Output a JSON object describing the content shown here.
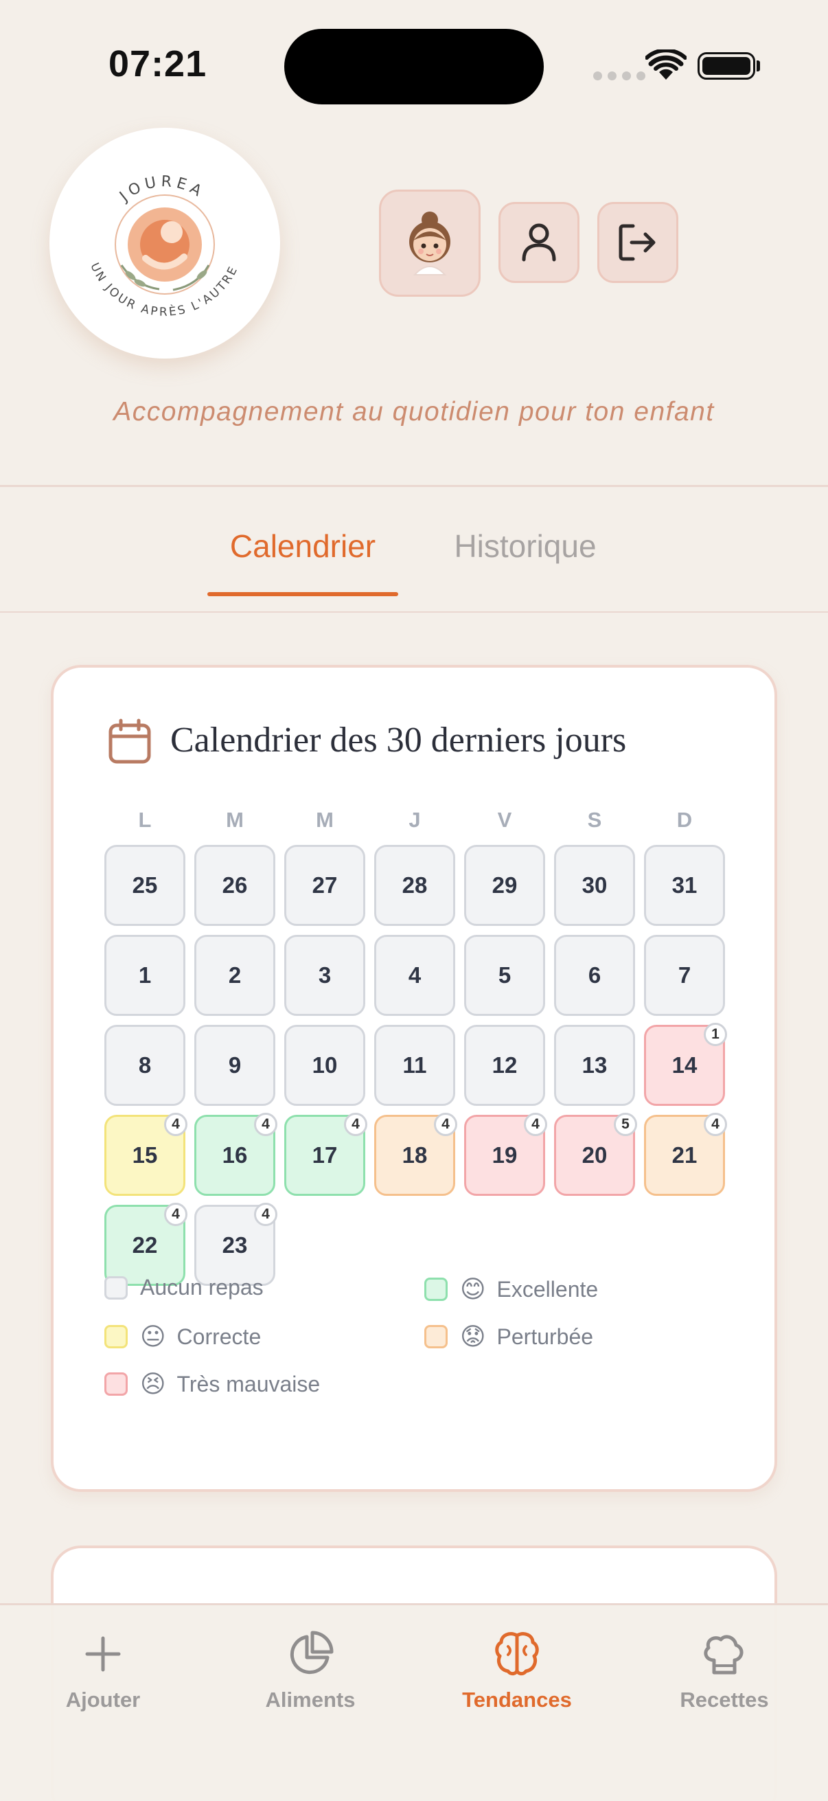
{
  "status_bar": {
    "time": "07:21"
  },
  "header": {
    "logo_text_top": "JOUREA",
    "logo_text_bottom": "UN JOUR APRÈS L'AUTRE",
    "profile_emoji": "👧",
    "tagline": "Accompagnement au quotidien pour ton enfant"
  },
  "tabs": [
    {
      "label": "Calendrier",
      "active": true
    },
    {
      "label": "Historique",
      "active": false
    }
  ],
  "calendar": {
    "title": "Calendrier des 30 derniers jours",
    "weekdays": [
      "L",
      "M",
      "M",
      "J",
      "V",
      "S",
      "D"
    ],
    "days": [
      {
        "n": "25",
        "s": "none"
      },
      {
        "n": "26",
        "s": "none"
      },
      {
        "n": "27",
        "s": "none"
      },
      {
        "n": "28",
        "s": "none"
      },
      {
        "n": "29",
        "s": "none"
      },
      {
        "n": "30",
        "s": "none"
      },
      {
        "n": "31",
        "s": "none"
      },
      {
        "n": "1",
        "s": "none"
      },
      {
        "n": "2",
        "s": "none"
      },
      {
        "n": "3",
        "s": "none"
      },
      {
        "n": "4",
        "s": "none"
      },
      {
        "n": "5",
        "s": "none"
      },
      {
        "n": "6",
        "s": "none"
      },
      {
        "n": "7",
        "s": "none"
      },
      {
        "n": "8",
        "s": "none"
      },
      {
        "n": "9",
        "s": "none"
      },
      {
        "n": "10",
        "s": "none"
      },
      {
        "n": "11",
        "s": "none"
      },
      {
        "n": "12",
        "s": "none"
      },
      {
        "n": "13",
        "s": "none"
      },
      {
        "n": "14",
        "s": "red",
        "count": "1"
      },
      {
        "n": "15",
        "s": "yellow",
        "count": "4"
      },
      {
        "n": "16",
        "s": "green",
        "count": "4"
      },
      {
        "n": "17",
        "s": "green",
        "count": "4"
      },
      {
        "n": "18",
        "s": "orange",
        "count": "4"
      },
      {
        "n": "19",
        "s": "red",
        "count": "4"
      },
      {
        "n": "20",
        "s": "red",
        "count": "5"
      },
      {
        "n": "21",
        "s": "orange",
        "count": "4"
      },
      {
        "n": "22",
        "s": "green",
        "count": "4"
      },
      {
        "n": "23",
        "s": "none",
        "count": "4"
      }
    ],
    "legend": [
      {
        "label": "Aucun repas",
        "s": "none",
        "emoji": ""
      },
      {
        "label": "Excellente",
        "s": "green",
        "emoji": "😊"
      },
      {
        "label": "Correcte",
        "s": "yellow",
        "emoji": "😐"
      },
      {
        "label": "Perturbée",
        "s": "orange",
        "emoji": "😟"
      },
      {
        "label": "Très mauvaise",
        "s": "red",
        "emoji": "😣"
      }
    ]
  },
  "bottom_nav": [
    {
      "label": "Ajouter",
      "icon": "plus-icon",
      "active": false
    },
    {
      "label": "Aliments",
      "icon": "pie-chart-icon",
      "active": false
    },
    {
      "label": "Tendances",
      "icon": "brain-icon",
      "active": true
    },
    {
      "label": "Recettes",
      "icon": "chef-hat-icon",
      "active": false
    }
  ],
  "colors": {
    "accent": "#e06a2c",
    "background": "#f4efe9",
    "tagline": "#cc8b6f"
  }
}
